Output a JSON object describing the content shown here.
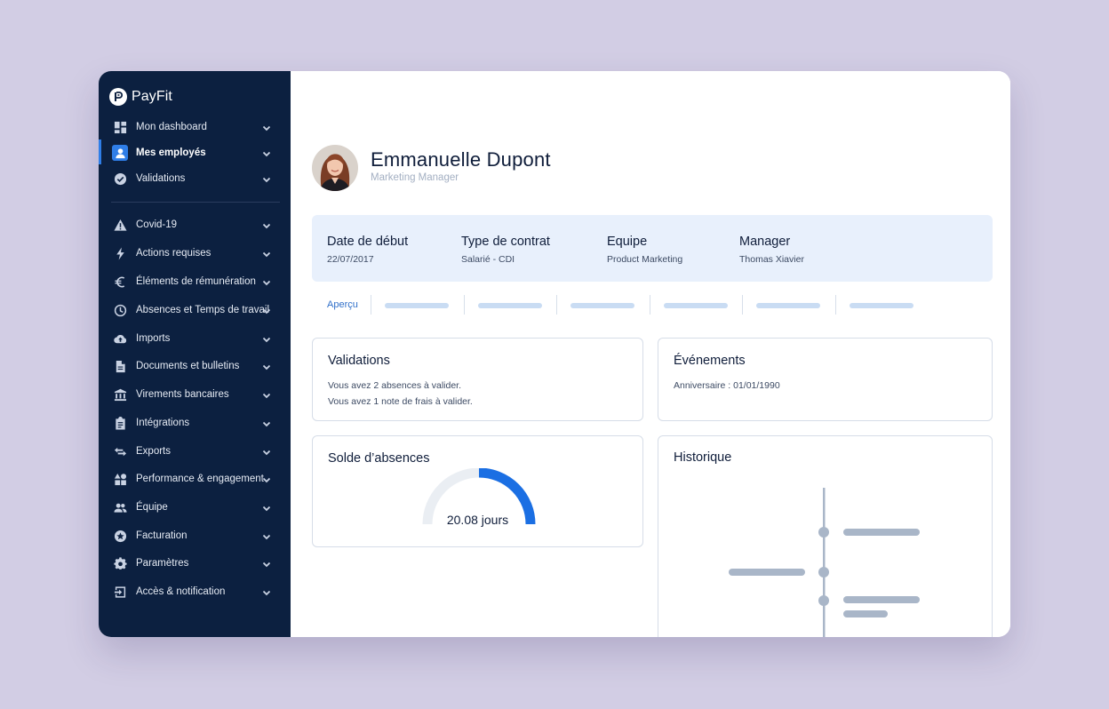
{
  "brand": {
    "name": "PayFit"
  },
  "sidebar": {
    "items": [
      {
        "label": "Mon dashboard",
        "icon": "dashboard-icon"
      },
      {
        "label": "Mes employés",
        "icon": "person-icon",
        "active": true
      },
      {
        "label": "Validations",
        "icon": "check-circle-icon"
      },
      {
        "label": "Covid-19",
        "icon": "warning-icon"
      },
      {
        "label": "Actions requises",
        "icon": "lightning-icon"
      },
      {
        "label": "Éléments de rémunération",
        "icon": "euro-icon"
      },
      {
        "label": "Absences et Temps de travail",
        "icon": "clock-icon"
      },
      {
        "label": "Imports",
        "icon": "cloud-upload-icon"
      },
      {
        "label": "Documents et bulletins",
        "icon": "document-icon"
      },
      {
        "label": "Virements bancaires",
        "icon": "bank-icon"
      },
      {
        "label": "Intégrations",
        "icon": "clipboard-icon"
      },
      {
        "label": "Exports",
        "icon": "swap-arrows-icon"
      },
      {
        "label": "Performance & engagement",
        "icon": "widgets-icon"
      },
      {
        "label": "Équipe",
        "icon": "group-icon"
      },
      {
        "label": "Facturation",
        "icon": "star-badge-icon"
      },
      {
        "label": "Paramètres",
        "icon": "gear-icon"
      },
      {
        "label": "Accès & notification",
        "icon": "login-icon"
      }
    ]
  },
  "employee": {
    "name": "Emmanuelle Dupont",
    "role": "Marketing Manager"
  },
  "info": [
    {
      "key": "Date de début",
      "value": "22/07/2017"
    },
    {
      "key": "Type de contrat",
      "value": "Salarié - CDI"
    },
    {
      "key": "Equipe",
      "value": "Product Marketing"
    },
    {
      "key": "Manager",
      "value": "Thomas Xiavier"
    }
  ],
  "tabs": {
    "active_label": "Aperçu"
  },
  "validations": {
    "title": "Validations",
    "lines": [
      "Vous avez 2 absences à valider.",
      "Vous avez 1 note de frais à valider."
    ]
  },
  "events": {
    "title": "Événements",
    "lines": [
      "Anniversaire : 01/01/1990"
    ]
  },
  "absences": {
    "title": "Solde d’absences",
    "balance_label": "20.08 jours",
    "gauge_fraction": 0.5
  },
  "history": {
    "title": "Historique"
  },
  "colors": {
    "background": "#d2cde4",
    "sidebar": "#0c2040",
    "accent": "#2f7ee8",
    "info_band": "#e8f0fc",
    "gauge_track": "#eaeef3",
    "timeline": "#a9b6c8"
  }
}
